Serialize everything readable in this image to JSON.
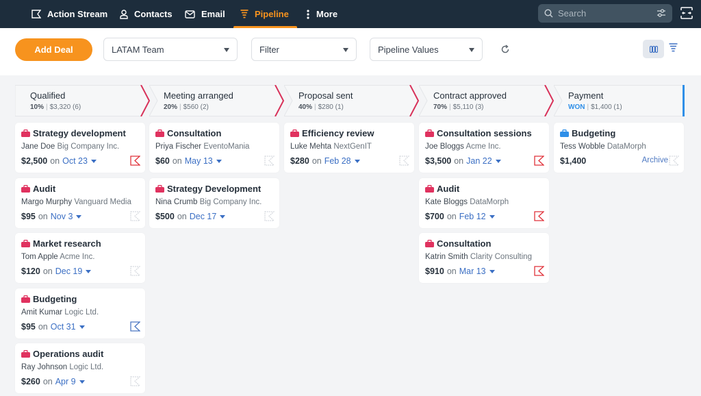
{
  "nav": {
    "items": [
      {
        "label": "Action Stream",
        "icon": "action-stream-icon",
        "active": false
      },
      {
        "label": "Contacts",
        "icon": "contacts-icon",
        "active": false
      },
      {
        "label": "Email",
        "icon": "email-icon",
        "active": false
      },
      {
        "label": "Pipeline",
        "icon": "pipeline-funnel-icon",
        "active": true
      },
      {
        "label": "More",
        "icon": "more-vertical-icon",
        "active": false
      }
    ],
    "search_placeholder": "Search"
  },
  "toolbar": {
    "add_deal_label": "Add Deal",
    "team_select": "LATAM Team",
    "filter_select": "Filter",
    "values_select": "Pipeline Values"
  },
  "colors": {
    "brand_orange": "#f7931e",
    "nav_bg": "#1d2d3c",
    "stage_arrow": "#d8325a",
    "won_blue": "#2f8fe8",
    "link_blue": "#3b6fc4",
    "deal_pink": "#e0325f",
    "deal_blue": "#2f8fe8",
    "flag_overdue": "#e0323a",
    "flag_active": "#4d78c2",
    "flag_none": "#d8dbe0"
  },
  "stages": [
    {
      "name": "Qualified",
      "pct": "10%",
      "summary": "$3,320 (6)",
      "deals": [
        {
          "title": "Strategy development",
          "contact": "Jane Doe",
          "org": "Big Company Inc.",
          "value": "$2,500",
          "on": "on",
          "date": "Oct 23",
          "flag": "overdue"
        },
        {
          "title": "Audit",
          "contact": "Margo Murphy",
          "org": "Vanguard Media",
          "value": "$95",
          "on": "on",
          "date": "Nov 3",
          "flag": "none"
        },
        {
          "title": "Market research",
          "contact": "Tom Apple",
          "org": "Acme Inc.",
          "value": "$120",
          "on": "on",
          "date": "Dec 19",
          "flag": "none"
        },
        {
          "title": "Budgeting",
          "contact": "Amit Kumar",
          "org": "Logic Ltd.",
          "value": "$95",
          "on": "on",
          "date": "Oct 31",
          "flag": "active"
        },
        {
          "title": "Operations audit",
          "contact": "Ray Johnson",
          "org": "Logic Ltd.",
          "value": "$260",
          "on": "on",
          "date": "Apr 9",
          "flag": "none"
        }
      ]
    },
    {
      "name": "Meeting arranged",
      "pct": "20%",
      "summary": "$560 (2)",
      "deals": [
        {
          "title": "Consultation",
          "contact": "Priya Fischer",
          "org": "EventoMania",
          "value": "$60",
          "on": "on",
          "date": "May 13",
          "flag": "none"
        },
        {
          "title": "Strategy Development",
          "contact": "Nina Crumb",
          "org": "Big Company Inc.",
          "value": "$500",
          "on": "on",
          "date": "Dec 17",
          "flag": "none"
        }
      ]
    },
    {
      "name": "Proposal sent",
      "pct": "40%",
      "summary": "$280 (1)",
      "deals": [
        {
          "title": "Efficiency review",
          "contact": "Luke Mehta",
          "org": "NextGenIT",
          "value": "$280",
          "on": "on",
          "date": "Feb 28",
          "flag": "none"
        }
      ]
    },
    {
      "name": "Contract approved",
      "pct": "70%",
      "summary": "$5,110 (3)",
      "deals": [
        {
          "title": "Consultation sessions",
          "contact": "Joe Bloggs",
          "org": "Acme Inc.",
          "value": "$3,500",
          "on": "on",
          "date": "Jan 22",
          "flag": "overdue"
        },
        {
          "title": "Audit",
          "contact": "Kate Bloggs",
          "org": "DataMorph",
          "value": "$700",
          "on": "on",
          "date": "Feb 12",
          "flag": "overdue"
        },
        {
          "title": "Consultation",
          "contact": "Katrin Smith",
          "org": "Clarity Consulting",
          "value": "$910",
          "on": "on",
          "date": "Mar 13",
          "flag": "overdue"
        }
      ]
    },
    {
      "name": "Payment",
      "pct": "WON",
      "summary": "$1,400 (1)",
      "deals": [
        {
          "title": "Budgeting",
          "contact": "Tess Wobble",
          "org": "DataMorph",
          "value": "$1,400",
          "archive": "Archive",
          "flag": "none",
          "won": true
        }
      ]
    }
  ]
}
